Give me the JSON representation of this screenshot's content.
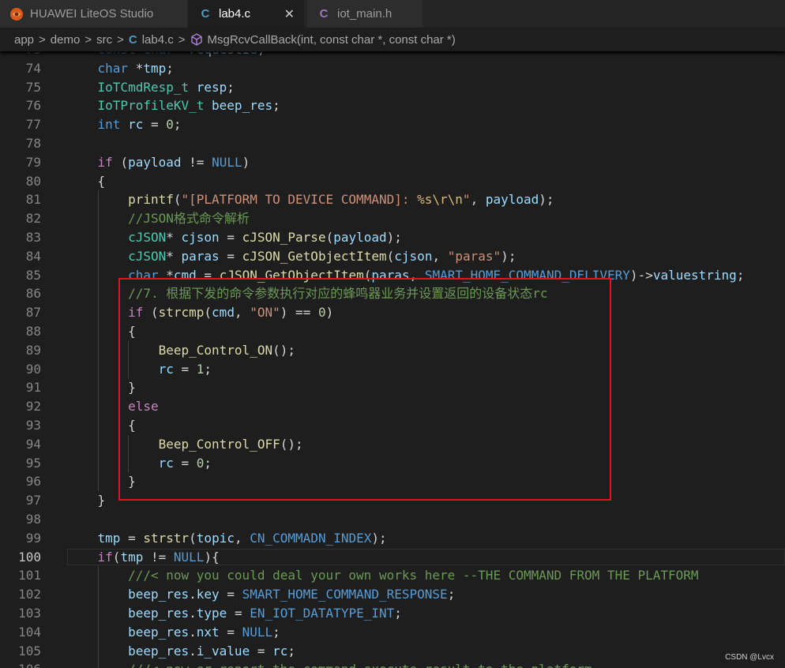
{
  "tabs": [
    {
      "label": "HUAWEI LiteOS Studio",
      "icon": "liteos-logo-icon",
      "active": false
    },
    {
      "label": "lab4.c",
      "icon": "c-file-icon",
      "active": true,
      "close": "✕"
    },
    {
      "label": "iot_main.h",
      "icon": "c-header-file-icon",
      "active": false
    }
  ],
  "breadcrumb": {
    "items": [
      "app",
      "demo",
      "src",
      "lab4.c",
      "MsgRcvCallBack(int, const char *, const char *)"
    ],
    "separator": ">"
  },
  "editor": {
    "current_line": 100,
    "lines": [
      {
        "n": "73",
        "text": "    const char *requestId;"
      },
      {
        "n": "74",
        "text": "    char *tmp;"
      },
      {
        "n": "75",
        "text": "    IoTCmdResp_t resp;"
      },
      {
        "n": "76",
        "text": "    IoTProfileKV_t beep_res;"
      },
      {
        "n": "77",
        "text": "    int rc = 0;"
      },
      {
        "n": "78",
        "text": ""
      },
      {
        "n": "79",
        "text": "    if (payload != NULL)"
      },
      {
        "n": "80",
        "text": "    {"
      },
      {
        "n": "81",
        "text": "        printf(\"[PLATFORM TO DEVICE COMMAND]: %s\\r\\n\", payload);"
      },
      {
        "n": "82",
        "text": "        //JSON格式命令解析"
      },
      {
        "n": "83",
        "text": "        cJSON* cjson = cJSON_Parse(payload);"
      },
      {
        "n": "84",
        "text": "        cJSON* paras = cJSON_GetObjectItem(cjson, \"paras\");"
      },
      {
        "n": "85",
        "text": "        char *cmd = cJSON_GetObjectItem(paras, SMART_HOME_COMMAND_DELIVERY)->valuestring;"
      },
      {
        "n": "86",
        "text": "        //7. 根据下发的命令参数执行对应的蜂鸣器业务并设置返回的设备状态rc"
      },
      {
        "n": "87",
        "text": "        if (strcmp(cmd, \"ON\") == 0)"
      },
      {
        "n": "88",
        "text": "        {"
      },
      {
        "n": "89",
        "text": "            Beep_Control_ON();"
      },
      {
        "n": "90",
        "text": "            rc = 1;"
      },
      {
        "n": "91",
        "text": "        }"
      },
      {
        "n": "92",
        "text": "        else"
      },
      {
        "n": "93",
        "text": "        {"
      },
      {
        "n": "94",
        "text": "            Beep_Control_OFF();"
      },
      {
        "n": "95",
        "text": "            rc = 0;"
      },
      {
        "n": "96",
        "text": "        }"
      },
      {
        "n": "97",
        "text": "    }"
      },
      {
        "n": "98",
        "text": ""
      },
      {
        "n": "99",
        "text": "    tmp = strstr(topic, CN_COMMADN_INDEX);"
      },
      {
        "n": "100",
        "text": "    if(tmp != NULL){"
      },
      {
        "n": "101",
        "text": "        ///< now you could deal your own works here --THE COMMAND FROM THE PLATFORM"
      },
      {
        "n": "102",
        "text": "        beep_res.key = SMART_HOME_COMMAND_RESPONSE;"
      },
      {
        "n": "103",
        "text": "        beep_res.type = EN_IOT_DATATYPE_INT;"
      },
      {
        "n": "104",
        "text": "        beep_res.nxt = NULL;"
      },
      {
        "n": "105",
        "text": "        beep_res.i_value = rc;"
      },
      {
        "n": "106",
        "text": "        ///< now er report the command execute result to the platform"
      }
    ]
  },
  "watermark": "CSDN @Lvcx",
  "colors": {
    "highlight_box": "#e81123",
    "background": "#1e1e1e"
  }
}
